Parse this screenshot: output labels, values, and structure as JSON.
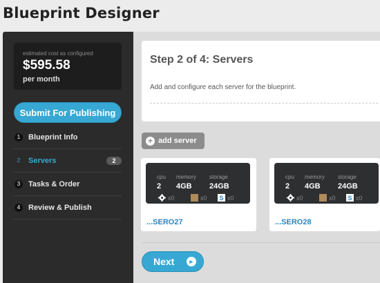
{
  "app": {
    "title": "Blueprint Designer"
  },
  "sidebar": {
    "cost": {
      "caption": "estimated cost as configured",
      "amount": "$595.58",
      "period": "per month"
    },
    "submit_label": "Submit For Publishing",
    "steps": [
      {
        "num": "1",
        "label": "Blueprint Info",
        "badge": ""
      },
      {
        "num": "2",
        "label": "Servers",
        "badge": "2",
        "active": true
      },
      {
        "num": "3",
        "label": "Tasks & Order",
        "badge": ""
      },
      {
        "num": "4",
        "label": "Review & Publish",
        "badge": ""
      }
    ]
  },
  "main": {
    "step_title": "Step 2 of 4: Servers",
    "step_description": "Add and configure each server for the blueprint.",
    "add_server_label": "add server",
    "spec_labels": {
      "cpu": "cpu",
      "memory": "memory",
      "storage": "storage"
    },
    "servers": [
      {
        "name": "...SERO27",
        "cpu": "2",
        "memory": "4GB",
        "storage": "24GB",
        "gear_count": "x0",
        "package_count": "x0",
        "script_count": "x0"
      },
      {
        "name": "...SERO28",
        "cpu": "2",
        "memory": "4GB",
        "storage": "24GB",
        "gear_count": "x0",
        "package_count": "x0",
        "script_count": "x0"
      }
    ],
    "next_label": "Next"
  },
  "icons": {
    "add": "plus-circle-icon",
    "gear": "gear-icon",
    "package": "package-icon",
    "script": "script-icon",
    "next": "arrow-right-icon"
  },
  "colors": {
    "accent": "#37a8d3",
    "sidebar_bg": "#2b2b2b",
    "link": "#2c86c1"
  }
}
